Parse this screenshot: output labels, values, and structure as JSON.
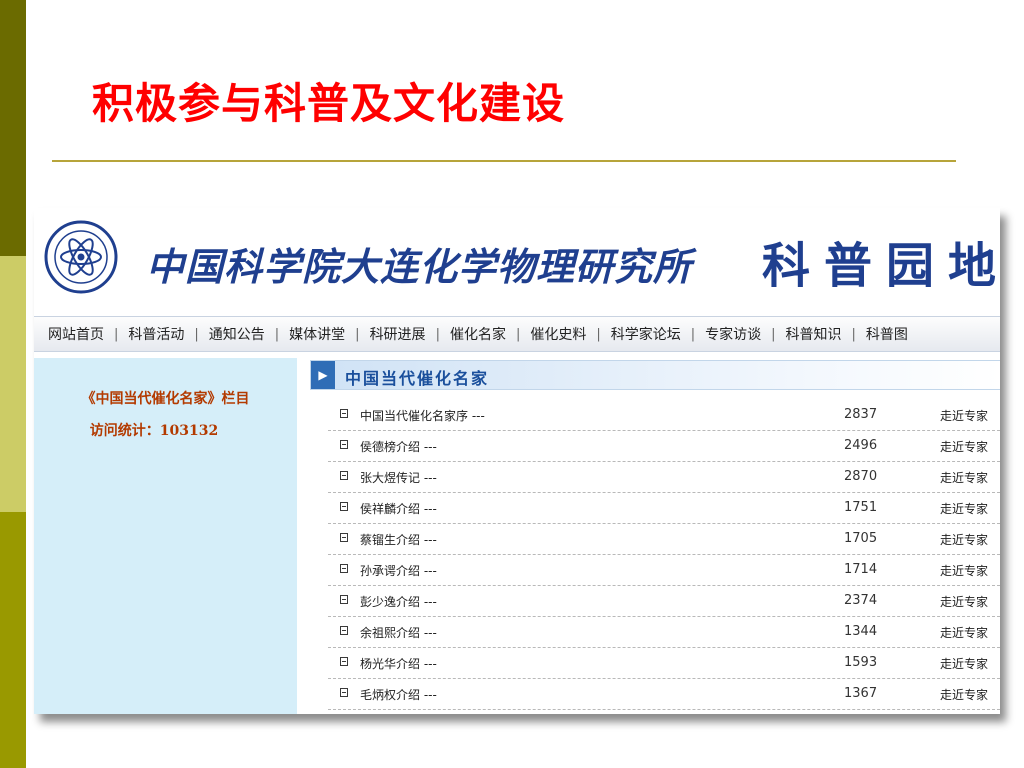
{
  "slide": {
    "title": "积极参与科普及文化建设"
  },
  "colors": {
    "title": "#ff0000",
    "accent": "#1f3f8f",
    "sidebar_bg": "#d5eef9",
    "sidebar_text": "#b33a00"
  },
  "banner": {
    "institute": "中国科学院大连化学物理研究所",
    "section": "科普园地",
    "emblem_icon": "atom-emblem-icon"
  },
  "nav": {
    "items": [
      "网站首页",
      "科普活动",
      "通知公告",
      "媒体讲堂",
      "科研进展",
      "催化名家",
      "催化史料",
      "科学家论坛",
      "专家访谈",
      "科普知识",
      "科普图"
    ],
    "separator": "|"
  },
  "sidebar": {
    "column_title": "《中国当代催化名家》栏目",
    "visit_stats": "访问统计：103132"
  },
  "section": {
    "title": "中国当代催化名家",
    "arrow_icon": "play-arrow-icon"
  },
  "articles": [
    {
      "title": "中国当代催化名家序 ---",
      "count": "2837",
      "link": "走近专家"
    },
    {
      "title": "侯德榜介绍 ---",
      "count": "2496",
      "link": "走近专家"
    },
    {
      "title": "张大煜传记 ---",
      "count": "2870",
      "link": "走近专家"
    },
    {
      "title": "侯祥麟介绍 ---",
      "count": "1751",
      "link": "走近专家"
    },
    {
      "title": "蔡镏生介绍 ---",
      "count": "1705",
      "link": "走近专家"
    },
    {
      "title": "孙承谔介绍 ---",
      "count": "1714",
      "link": "走近专家"
    },
    {
      "title": "彭少逸介绍 ---",
      "count": "2374",
      "link": "走近专家"
    },
    {
      "title": "余祖熙介绍 ---",
      "count": "1344",
      "link": "走近专家"
    },
    {
      "title": "杨光华介绍 ---",
      "count": "1593",
      "link": "走近专家"
    },
    {
      "title": "毛炳权介绍 ---",
      "count": "1367",
      "link": "走近专家"
    }
  ]
}
